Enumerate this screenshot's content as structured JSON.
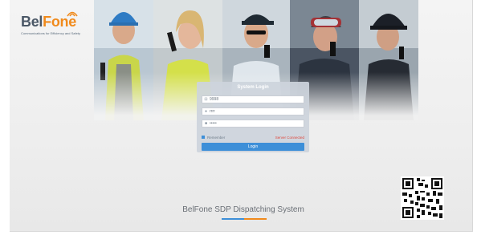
{
  "brand": {
    "name_part1": "Bel",
    "name_part2": "Fone",
    "tagline": "Communications for Efficiency and Safety"
  },
  "login": {
    "title": "System Login",
    "server_value": "9998",
    "user_value": "rrrr",
    "password_value": "•••••",
    "remember_label": "Remember",
    "status_text": "Server Connected",
    "button_label": "Login"
  },
  "footer": {
    "system_title": "BelFone SDP Dispatching System"
  },
  "colors": {
    "accent_blue": "#3d8fd8",
    "brand_orange": "#f08a1c",
    "status_red": "#e0463a"
  },
  "icons": [
    "server-icon",
    "user-icon",
    "lock-icon",
    "checkbox-checked-icon",
    "qr-code-icon"
  ]
}
